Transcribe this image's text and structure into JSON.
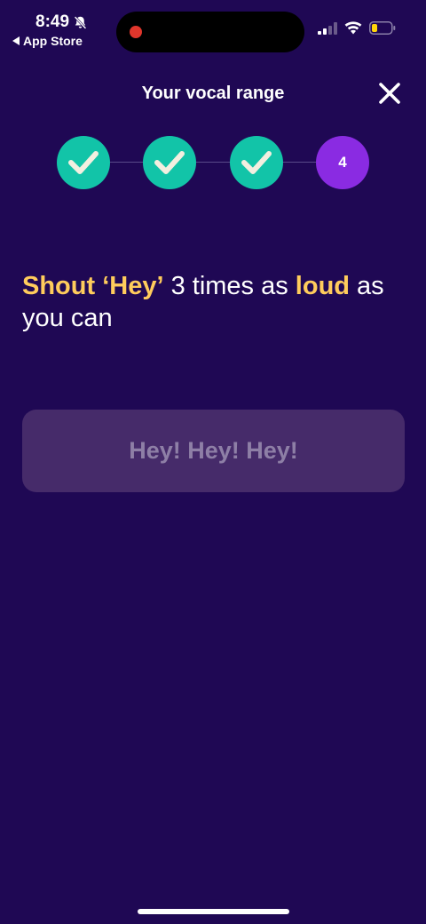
{
  "status_bar": {
    "time": "8:49",
    "back_label": "App Store",
    "battery_color": "#ffd60a"
  },
  "header": {
    "title": "Your vocal range",
    "close_icon": "close-icon"
  },
  "stepper": {
    "steps": [
      {
        "state": "done",
        "icon": "check-icon"
      },
      {
        "state": "done",
        "icon": "check-icon"
      },
      {
        "state": "done",
        "icon": "check-icon"
      },
      {
        "state": "current",
        "label": "4"
      }
    ]
  },
  "instruction": {
    "part1": "Shout ‘Hey’",
    "part2": " 3 times as ",
    "part3": "loud",
    "part4": " as you can"
  },
  "phrase_card": {
    "text": "Hey! Hey! Hey!"
  },
  "colors": {
    "background": "#1f0854",
    "accent_teal": "#12c4a8",
    "accent_purple": "#8a2be2",
    "highlight_yellow": "#ffcc5c"
  }
}
